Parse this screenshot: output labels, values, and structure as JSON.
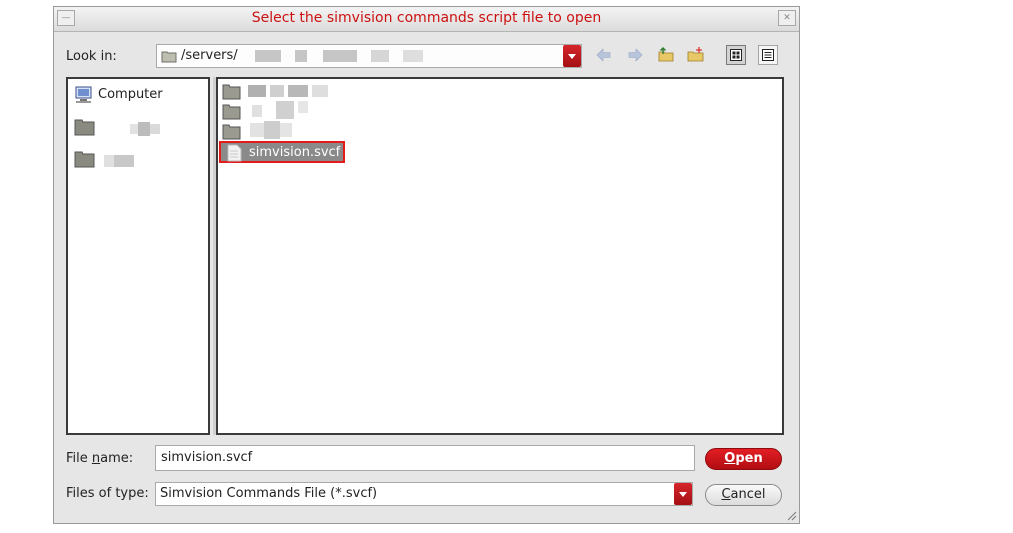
{
  "window": {
    "title": "Select the simvision commands script file to open"
  },
  "look_in": {
    "label": "Look in:",
    "path": "/servers/"
  },
  "toolbar": {
    "icons": [
      "back-arrow-icon",
      "forward-arrow-icon",
      "parent-folder-icon",
      "new-folder-icon",
      "list-view-icon",
      "detail-view-icon"
    ]
  },
  "sidebar": {
    "items": [
      {
        "label": "Computer",
        "icon": "computer-icon"
      },
      {
        "label": "",
        "icon": "folder-icon"
      },
      {
        "label": "",
        "icon": "folder-icon"
      }
    ]
  },
  "files": [
    {
      "name": "",
      "kind": "folder"
    },
    {
      "name": "",
      "kind": "folder"
    },
    {
      "name": "",
      "kind": "folder"
    },
    {
      "name": "simvision.svcf",
      "kind": "file",
      "selected": true
    }
  ],
  "file_name": {
    "label_pre": "File ",
    "label_mnemonic": "n",
    "label_post": "ame:",
    "value": "simvision.svcf"
  },
  "file_type": {
    "label": "Files of type:",
    "value": "Simvision Commands File (*.svcf)"
  },
  "buttons": {
    "open_mnemonic": "O",
    "open_rest": "pen",
    "cancel_mnemonic": "C",
    "cancel_rest": "ancel"
  },
  "colors": {
    "accent": "#cc1111",
    "selection": "#8a8a8a",
    "highlight_border": "#e31b1b"
  }
}
